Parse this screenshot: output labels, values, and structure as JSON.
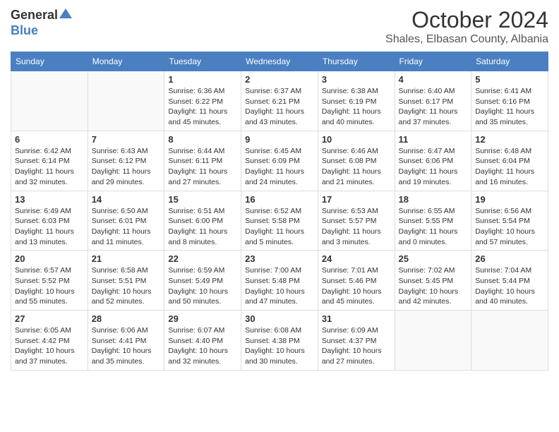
{
  "header": {
    "logo_general": "General",
    "logo_blue": "Blue",
    "month": "October 2024",
    "location": "Shales, Elbasan County, Albania"
  },
  "weekdays": [
    "Sunday",
    "Monday",
    "Tuesday",
    "Wednesday",
    "Thursday",
    "Friday",
    "Saturday"
  ],
  "weeks": [
    [
      {
        "day": "",
        "info": ""
      },
      {
        "day": "",
        "info": ""
      },
      {
        "day": "1",
        "info": "Sunrise: 6:36 AM\nSunset: 6:22 PM\nDaylight: 11 hours\nand 45 minutes."
      },
      {
        "day": "2",
        "info": "Sunrise: 6:37 AM\nSunset: 6:21 PM\nDaylight: 11 hours\nand 43 minutes."
      },
      {
        "day": "3",
        "info": "Sunrise: 6:38 AM\nSunset: 6:19 PM\nDaylight: 11 hours\nand 40 minutes."
      },
      {
        "day": "4",
        "info": "Sunrise: 6:40 AM\nSunset: 6:17 PM\nDaylight: 11 hours\nand 37 minutes."
      },
      {
        "day": "5",
        "info": "Sunrise: 6:41 AM\nSunset: 6:16 PM\nDaylight: 11 hours\nand 35 minutes."
      }
    ],
    [
      {
        "day": "6",
        "info": "Sunrise: 6:42 AM\nSunset: 6:14 PM\nDaylight: 11 hours\nand 32 minutes."
      },
      {
        "day": "7",
        "info": "Sunrise: 6:43 AM\nSunset: 6:12 PM\nDaylight: 11 hours\nand 29 minutes."
      },
      {
        "day": "8",
        "info": "Sunrise: 6:44 AM\nSunset: 6:11 PM\nDaylight: 11 hours\nand 27 minutes."
      },
      {
        "day": "9",
        "info": "Sunrise: 6:45 AM\nSunset: 6:09 PM\nDaylight: 11 hours\nand 24 minutes."
      },
      {
        "day": "10",
        "info": "Sunrise: 6:46 AM\nSunset: 6:08 PM\nDaylight: 11 hours\nand 21 minutes."
      },
      {
        "day": "11",
        "info": "Sunrise: 6:47 AM\nSunset: 6:06 PM\nDaylight: 11 hours\nand 19 minutes."
      },
      {
        "day": "12",
        "info": "Sunrise: 6:48 AM\nSunset: 6:04 PM\nDaylight: 11 hours\nand 16 minutes."
      }
    ],
    [
      {
        "day": "13",
        "info": "Sunrise: 6:49 AM\nSunset: 6:03 PM\nDaylight: 11 hours\nand 13 minutes."
      },
      {
        "day": "14",
        "info": "Sunrise: 6:50 AM\nSunset: 6:01 PM\nDaylight: 11 hours\nand 11 minutes."
      },
      {
        "day": "15",
        "info": "Sunrise: 6:51 AM\nSunset: 6:00 PM\nDaylight: 11 hours\nand 8 minutes."
      },
      {
        "day": "16",
        "info": "Sunrise: 6:52 AM\nSunset: 5:58 PM\nDaylight: 11 hours\nand 5 minutes."
      },
      {
        "day": "17",
        "info": "Sunrise: 6:53 AM\nSunset: 5:57 PM\nDaylight: 11 hours\nand 3 minutes."
      },
      {
        "day": "18",
        "info": "Sunrise: 6:55 AM\nSunset: 5:55 PM\nDaylight: 11 hours\nand 0 minutes."
      },
      {
        "day": "19",
        "info": "Sunrise: 6:56 AM\nSunset: 5:54 PM\nDaylight: 10 hours\nand 57 minutes."
      }
    ],
    [
      {
        "day": "20",
        "info": "Sunrise: 6:57 AM\nSunset: 5:52 PM\nDaylight: 10 hours\nand 55 minutes."
      },
      {
        "day": "21",
        "info": "Sunrise: 6:58 AM\nSunset: 5:51 PM\nDaylight: 10 hours\nand 52 minutes."
      },
      {
        "day": "22",
        "info": "Sunrise: 6:59 AM\nSunset: 5:49 PM\nDaylight: 10 hours\nand 50 minutes."
      },
      {
        "day": "23",
        "info": "Sunrise: 7:00 AM\nSunset: 5:48 PM\nDaylight: 10 hours\nand 47 minutes."
      },
      {
        "day": "24",
        "info": "Sunrise: 7:01 AM\nSunset: 5:46 PM\nDaylight: 10 hours\nand 45 minutes."
      },
      {
        "day": "25",
        "info": "Sunrise: 7:02 AM\nSunset: 5:45 PM\nDaylight: 10 hours\nand 42 minutes."
      },
      {
        "day": "26",
        "info": "Sunrise: 7:04 AM\nSunset: 5:44 PM\nDaylight: 10 hours\nand 40 minutes."
      }
    ],
    [
      {
        "day": "27",
        "info": "Sunrise: 6:05 AM\nSunset: 4:42 PM\nDaylight: 10 hours\nand 37 minutes."
      },
      {
        "day": "28",
        "info": "Sunrise: 6:06 AM\nSunset: 4:41 PM\nDaylight: 10 hours\nand 35 minutes."
      },
      {
        "day": "29",
        "info": "Sunrise: 6:07 AM\nSunset: 4:40 PM\nDaylight: 10 hours\nand 32 minutes."
      },
      {
        "day": "30",
        "info": "Sunrise: 6:08 AM\nSunset: 4:38 PM\nDaylight: 10 hours\nand 30 minutes."
      },
      {
        "day": "31",
        "info": "Sunrise: 6:09 AM\nSunset: 4:37 PM\nDaylight: 10 hours\nand 27 minutes."
      },
      {
        "day": "",
        "info": ""
      },
      {
        "day": "",
        "info": ""
      }
    ]
  ]
}
